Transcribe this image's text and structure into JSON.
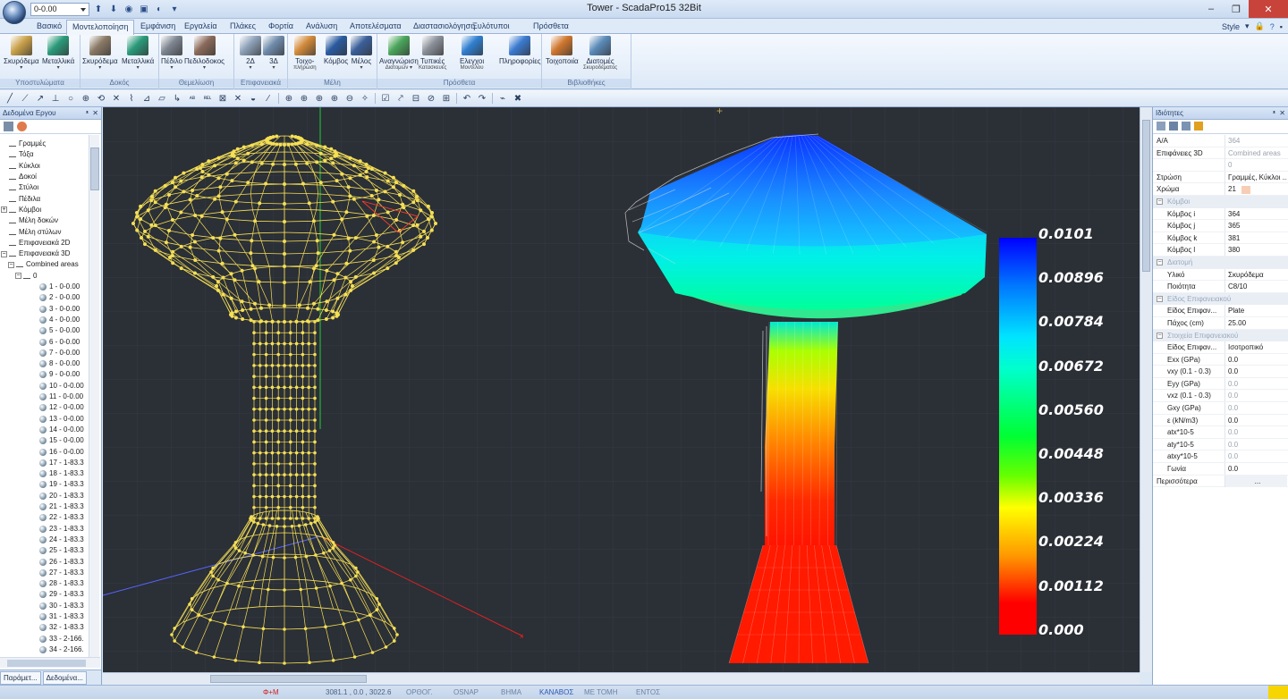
{
  "window": {
    "title": "Tower - ScadaPro15 32Bit",
    "minimize": "–",
    "maximize": "❐",
    "close": "✕"
  },
  "qat": {
    "layer_value": "0-0.00",
    "more": "▾"
  },
  "tabs": [
    {
      "label": "Βασικό"
    },
    {
      "label": "Μοντελοποίηση",
      "active": true
    },
    {
      "label": "Εμφάνιση"
    },
    {
      "label": "Εργαλεία"
    },
    {
      "label": "Πλάκες"
    },
    {
      "label": "Φορτία"
    },
    {
      "label": "Ανάλυση"
    },
    {
      "label": "Αποτελέσματα"
    },
    {
      "label": "Διαστασιολόγηση"
    },
    {
      "label": "Ξυλότυποι"
    },
    {
      "label": "Πρόσθετα"
    }
  ],
  "style_label": "Style",
  "ribbon": {
    "groups": [
      {
        "label": "Υποστυλώματα",
        "buttons": [
          {
            "l1": "Σκυρόδεμα",
            "l2": "▾",
            "icon": "column-concrete-icon",
            "color": "#c9a14a"
          },
          {
            "l1": "Μεταλλικά",
            "l2": "▾",
            "icon": "column-steel-icon",
            "color": "#2a9a7a"
          }
        ]
      },
      {
        "label": "Δοκός",
        "buttons": [
          {
            "l1": "Σκυρόδεμα",
            "l2": "▾",
            "icon": "beam-concrete-icon",
            "color": "#8a7a66"
          },
          {
            "l1": "Μεταλλικά",
            "l2": "▾",
            "icon": "beam-steel-icon",
            "color": "#2a9a7a"
          }
        ]
      },
      {
        "label": "Θεμελίωση",
        "buttons": [
          {
            "l1": "Πέδιλο",
            "l2": "▾",
            "icon": "footing-icon",
            "color": "#7d8590"
          },
          {
            "l1": "Πεδιλοδοκος",
            "l2": "▾",
            "icon": "footing-beam-icon",
            "color": "#8a6a5a"
          }
        ]
      },
      {
        "label": "Επιφανειακά",
        "buttons": [
          {
            "l1": "2Δ",
            "l2": "▾",
            "icon": "surface-2d-icon",
            "color": "#8da0b8"
          },
          {
            "l1": "3Δ",
            "l2": "▾",
            "icon": "surface-3d-icon",
            "color": "#6f8bab"
          }
        ]
      },
      {
        "label": "Μέλη",
        "buttons": [
          {
            "l1": "Τοιχο-",
            "l2": "πλήρωση",
            "icon": "infill-wall-icon",
            "color": "#d28a3a"
          },
          {
            "l1": "Κόμβος",
            "l2": "",
            "icon": "node-icon",
            "color": "#2a5aa0"
          },
          {
            "l1": "Μέλος",
            "l2": "▾",
            "icon": "member-icon",
            "color": "#3a5f9a"
          }
        ]
      },
      {
        "label": "Πρόσθετα",
        "buttons": [
          {
            "l1": "Αναγνώριση",
            "l2": "Διατομών ▾",
            "icon": "section-recognition-icon",
            "color": "#4aa55a"
          },
          {
            "l1": "Τυπικές",
            "l2": "Κατασκευές",
            "icon": "typical-structures-icon",
            "color": "#8a8f98"
          },
          {
            "l1": "Ελεγχοι",
            "l2": "Μοντέλου",
            "icon": "model-check-icon",
            "color": "#2f7fd0"
          },
          {
            "l1": "Πληροφορίες",
            "l2": "",
            "icon": "info-icon",
            "color": "#3a7ad0"
          }
        ]
      },
      {
        "label": "Βιβλιοθήκες",
        "buttons": [
          {
            "l1": "Τοιχοποιία",
            "l2": "",
            "icon": "masonry-icon",
            "color": "#d0772e"
          },
          {
            "l1": "Διατομές",
            "l2": "Σκυροδέματος",
            "icon": "concrete-sections-icon",
            "color": "#5a8ab8"
          }
        ]
      }
    ]
  },
  "left_panel": {
    "title": "Δεδομένα Εργου",
    "tree": [
      {
        "label": "Γραμμές",
        "level": 1,
        "icon": "line-icon"
      },
      {
        "label": "Τόξα",
        "level": 1,
        "icon": "arc-icon"
      },
      {
        "label": "Κύκλοι",
        "level": 1,
        "icon": "circle-icon"
      },
      {
        "label": "Δοκοί",
        "level": 1,
        "icon": "beam-icon"
      },
      {
        "label": "Στύλοι",
        "level": 1,
        "icon": "column-icon"
      },
      {
        "label": "Πέδιλα",
        "level": 1,
        "icon": "footing-icon"
      },
      {
        "label": "Κόμβοι",
        "level": 1,
        "icon": "node-icon",
        "expander": "+"
      },
      {
        "label": "Μέλη δοκών",
        "level": 1,
        "icon": "beam-member-icon"
      },
      {
        "label": "Μέλη στύλων",
        "level": 1,
        "icon": "column-member-icon"
      },
      {
        "label": "Επιφανειακά 2D",
        "level": 1,
        "icon": "surface-2d-icon"
      },
      {
        "label": "Επιφανειακά 3D",
        "level": 1,
        "icon": "surface-3d-icon",
        "expander": "-"
      },
      {
        "label": "Combined areas",
        "level": 2,
        "icon": "area-icon",
        "expander": "-"
      },
      {
        "label": "0",
        "level": 3,
        "icon": "area-icon",
        "expander": "-"
      },
      {
        "label": "1 - 0-0.00",
        "level": 4
      },
      {
        "label": "2 - 0-0.00",
        "level": 4
      },
      {
        "label": "3 - 0-0.00",
        "level": 4
      },
      {
        "label": "4 - 0-0.00",
        "level": 4
      },
      {
        "label": "5 - 0-0.00",
        "level": 4
      },
      {
        "label": "6 - 0-0.00",
        "level": 4
      },
      {
        "label": "7 - 0-0.00",
        "level": 4
      },
      {
        "label": "8 - 0-0.00",
        "level": 4
      },
      {
        "label": "9 - 0-0.00",
        "level": 4
      },
      {
        "label": "10 - 0-0.00",
        "level": 4
      },
      {
        "label": "11 - 0-0.00",
        "level": 4
      },
      {
        "label": "12 - 0-0.00",
        "level": 4
      },
      {
        "label": "13 - 0-0.00",
        "level": 4
      },
      {
        "label": "14 - 0-0.00",
        "level": 4
      },
      {
        "label": "15 - 0-0.00",
        "level": 4
      },
      {
        "label": "16 - 0-0.00",
        "level": 4
      },
      {
        "label": "17 - 1-83.3",
        "level": 4
      },
      {
        "label": "18 - 1-83.3",
        "level": 4
      },
      {
        "label": "19 - 1-83.3",
        "level": 4
      },
      {
        "label": "20 - 1-83.3",
        "level": 4
      },
      {
        "label": "21 - 1-83.3",
        "level": 4
      },
      {
        "label": "22 - 1-83.3",
        "level": 4
      },
      {
        "label": "23 - 1-83.3",
        "level": 4
      },
      {
        "label": "24 - 1-83.3",
        "level": 4
      },
      {
        "label": "25 - 1-83.3",
        "level": 4
      },
      {
        "label": "26 - 1-83.3",
        "level": 4
      },
      {
        "label": "27 - 1-83.3",
        "level": 4
      },
      {
        "label": "28 - 1-83.3",
        "level": 4
      },
      {
        "label": "29 - 1-83.3",
        "level": 4
      },
      {
        "label": "30 - 1-83.3",
        "level": 4
      },
      {
        "label": "31 - 1-83.3",
        "level": 4
      },
      {
        "label": "32 - 1-83.3",
        "level": 4
      },
      {
        "label": "33 - 2-166.",
        "level": 4
      },
      {
        "label": "34 - 2-166.",
        "level": 4
      }
    ],
    "bottom_tabs": [
      "Παράμετ...",
      "Δεδομένα..."
    ]
  },
  "legend": {
    "values": [
      "0.0101",
      "0.00896",
      "0.00784",
      "0.00672",
      "0.00560",
      "0.00448",
      "0.00336",
      "0.00224",
      "0.00112",
      "0.000"
    ],
    "colors": {
      "max": "#0000ff",
      "min": "#ff0000"
    }
  },
  "right_panel": {
    "title": "Ιδιότητες",
    "rows": [
      {
        "type": "row",
        "key": "Α/Α",
        "value": "364",
        "disabled": true
      },
      {
        "type": "row",
        "key": "Επιφάνειες 3D",
        "value": "Combined areas",
        "disabled": true
      },
      {
        "type": "row",
        "key": "",
        "value": "0",
        "disabled": true
      },
      {
        "type": "row",
        "key": "Στρώση",
        "value": "Γραμμές, Κύκλοι ..."
      },
      {
        "type": "row",
        "key": "Χρώμα",
        "value": "21",
        "swatch": "#f8cdb5"
      },
      {
        "type": "cat",
        "label": "Κόμβοι"
      },
      {
        "type": "row",
        "key": "Κόμβος i",
        "value": "364",
        "indent": true
      },
      {
        "type": "row",
        "key": "Κόμβος j",
        "value": "365",
        "indent": true
      },
      {
        "type": "row",
        "key": "Κόμβος k",
        "value": "381",
        "indent": true
      },
      {
        "type": "row",
        "key": "Κόμβος l",
        "value": "380",
        "indent": true
      },
      {
        "type": "cat",
        "label": "Διατομή"
      },
      {
        "type": "row",
        "key": "Υλικό",
        "value": "Σκυρόδεμα",
        "indent": true
      },
      {
        "type": "row",
        "key": "Ποιότητα",
        "value": "C8/10",
        "indent": true
      },
      {
        "type": "cat",
        "label": "Είδος Επιφανειακού"
      },
      {
        "type": "row",
        "key": "Είδος Επιφαν...",
        "value": "Plate",
        "indent": true
      },
      {
        "type": "row",
        "key": "Πάχος (cm)",
        "value": "25.00",
        "indent": true
      },
      {
        "type": "cat",
        "label": "Στοιχεία Επιφανειακού"
      },
      {
        "type": "row",
        "key": "Είδος Επιφαν...",
        "value": "Ισοτροπικό",
        "indent": true
      },
      {
        "type": "row",
        "key": "Exx (GPa)",
        "value": "0.0",
        "indent": true
      },
      {
        "type": "row",
        "key": "vxy (0.1 - 0.3)",
        "value": "0.0",
        "indent": true
      },
      {
        "type": "row",
        "key": "Eyy (GPa)",
        "value": "0.0",
        "indent": true,
        "disabled": true
      },
      {
        "type": "row",
        "key": "vxz (0.1 - 0.3)",
        "value": "0.0",
        "indent": true,
        "disabled": true
      },
      {
        "type": "row",
        "key": "Gxy (GPa)",
        "value": "0.0",
        "indent": true,
        "disabled": true
      },
      {
        "type": "row",
        "key": "ε (kN/m3)",
        "value": "0.0",
        "indent": true
      },
      {
        "type": "row",
        "key": "atx*10-5",
        "value": "0.0",
        "indent": true,
        "disabled": true
      },
      {
        "type": "row",
        "key": "aty*10-5",
        "value": "0.0",
        "indent": true,
        "disabled": true
      },
      {
        "type": "row",
        "key": "atxy*10-5",
        "value": "0.0",
        "indent": true,
        "disabled": true
      },
      {
        "type": "row",
        "key": "Γωνία",
        "value": "0.0",
        "indent": true
      },
      {
        "type": "row",
        "key": "Περισσότερα",
        "value": "...",
        "center": true
      }
    ]
  },
  "status": {
    "mode": "Φ+Μ",
    "coords": "3081.1 , 0.0 , 3022.6",
    "ortho": "ΟΡΘΟΓ.",
    "osnap": "OSNAP",
    "step": "ΒΗΜΑ",
    "canvas": "ΚΑΝΑΒΟΣ",
    "section": "ΜΕ ΤΟΜΗ",
    "inside": "ΕΝΤΟΣ"
  },
  "colors": {
    "viewport_bg": "#2b2f36",
    "wire": "#f5df55",
    "accent": "#c8433a"
  }
}
